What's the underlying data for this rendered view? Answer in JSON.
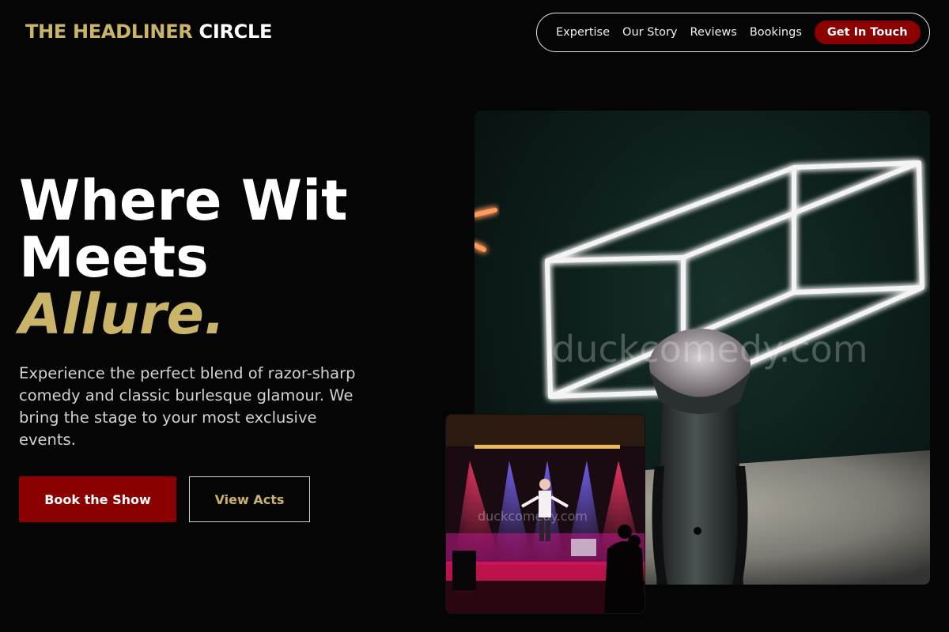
{
  "brand": {
    "part1": "THE HEADLINER",
    "part2": "CIRCLE"
  },
  "nav": {
    "items": [
      "Expertise",
      "Our Story",
      "Reviews",
      "Bookings"
    ],
    "cta": "Get In Touch"
  },
  "hero": {
    "line1": "Where Wit",
    "line2": "Meets",
    "line3": "Allure.",
    "subtitle": "Experience the perfect blend of razor-sharp comedy and classic burlesque glamour. We bring the stage to your most exclusive events.",
    "primary_button": "Book the Show",
    "secondary_button": "View Acts"
  },
  "images": {
    "main_watermark": "duckcomedy.com",
    "stage_watermark": "duckcomedy.com"
  },
  "colors": {
    "gold": "#c9b46a",
    "red": "#8b0000",
    "background": "#050505"
  }
}
